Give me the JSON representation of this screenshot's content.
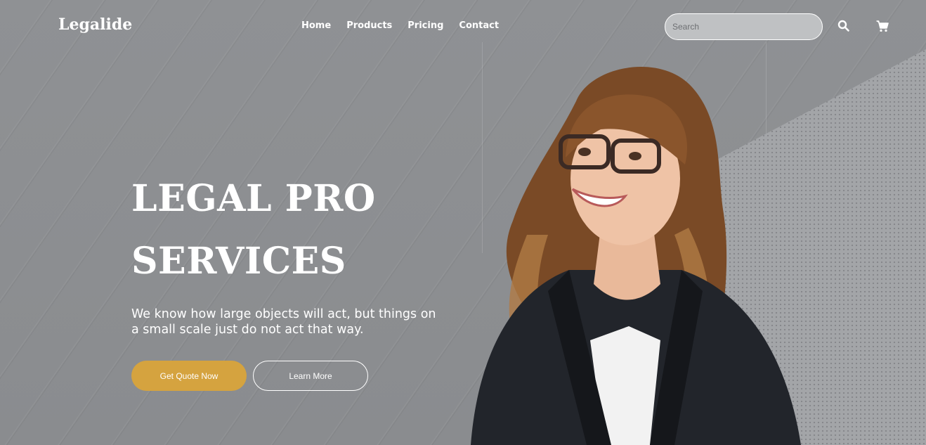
{
  "brand": {
    "logo": "Legalide"
  },
  "nav": {
    "items": [
      {
        "label": "Home"
      },
      {
        "label": "Products"
      },
      {
        "label": "Pricing"
      },
      {
        "label": "Contact"
      }
    ]
  },
  "search": {
    "placeholder": "Search",
    "value": ""
  },
  "icons": {
    "search": "search-icon",
    "cart": "cart-icon"
  },
  "hero": {
    "title_line1": "LEGAL PRO",
    "title_line2": "SERVICES",
    "subtitle": "We know how large objects will act, but things on a small scale just do not act that way.",
    "primary_button": "Get Quote Now",
    "secondary_button": "Learn More"
  },
  "colors": {
    "accent": "#d5a33f",
    "background": "#8c8e91",
    "text": "#ffffff"
  }
}
